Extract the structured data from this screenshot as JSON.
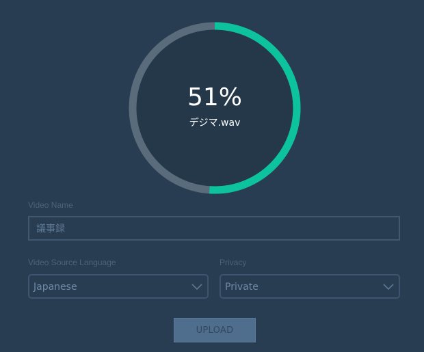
{
  "progress": {
    "percent_label": "51%",
    "fraction": 0.51,
    "file_name": "デジマ.wav",
    "track_color": "#5a6b7b",
    "fill_color": "#0cc39e",
    "inner_color": "#24384a"
  },
  "form": {
    "video_name": {
      "label": "Video Name",
      "value": "議事録"
    },
    "source_language": {
      "label": "Video Source Language",
      "selected": "Japanese"
    },
    "privacy": {
      "label": "Privacy",
      "selected": "Private"
    },
    "upload_label": "UPLOAD"
  },
  "icons": {
    "select_arrow": "chevron-down-icon"
  }
}
